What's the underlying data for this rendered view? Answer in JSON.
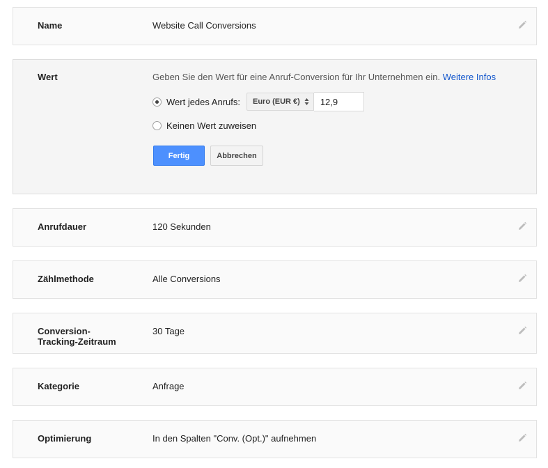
{
  "rows": {
    "name": {
      "label": "Name",
      "value": "Website Call Conversions"
    },
    "wert": {
      "label": "Wert",
      "description": "Geben Sie den Wert für eine Anruf-Conversion für Ihr Unternehmen ein.",
      "more_info_link": "Weitere Infos",
      "option_value_label": "Wert jedes Anrufs:",
      "currency_selected": "Euro (EUR €)",
      "amount_value": "12,9",
      "option_none_label": "Keinen Wert zuweisen",
      "done_button": "Fertig",
      "cancel_button": "Abbrechen"
    },
    "anrufdauer": {
      "label": "Anrufdauer",
      "value": "120 Sekunden"
    },
    "zaehlmethode": {
      "label": "Zählmethode",
      "value": "Alle Conversions"
    },
    "zeitraum": {
      "label_line1": "Conversion-",
      "label_line2": "Tracking-Zeitraum",
      "value": "30 Tage"
    },
    "kategorie": {
      "label": "Kategorie",
      "value": "Anfrage"
    },
    "optimierung": {
      "label": "Optimierung",
      "value": "In den Spalten \"Conv. (Opt.)\" aufnehmen"
    }
  },
  "icons": {
    "edit": "pencil-icon",
    "radio_checked": "radio-checked",
    "select_arrows": "up-down-arrows-icon"
  },
  "colors": {
    "primary_button": "#4d90fe",
    "link": "#1155cc",
    "card_background": "#fafafa",
    "card_border": "#e2e2e2"
  }
}
